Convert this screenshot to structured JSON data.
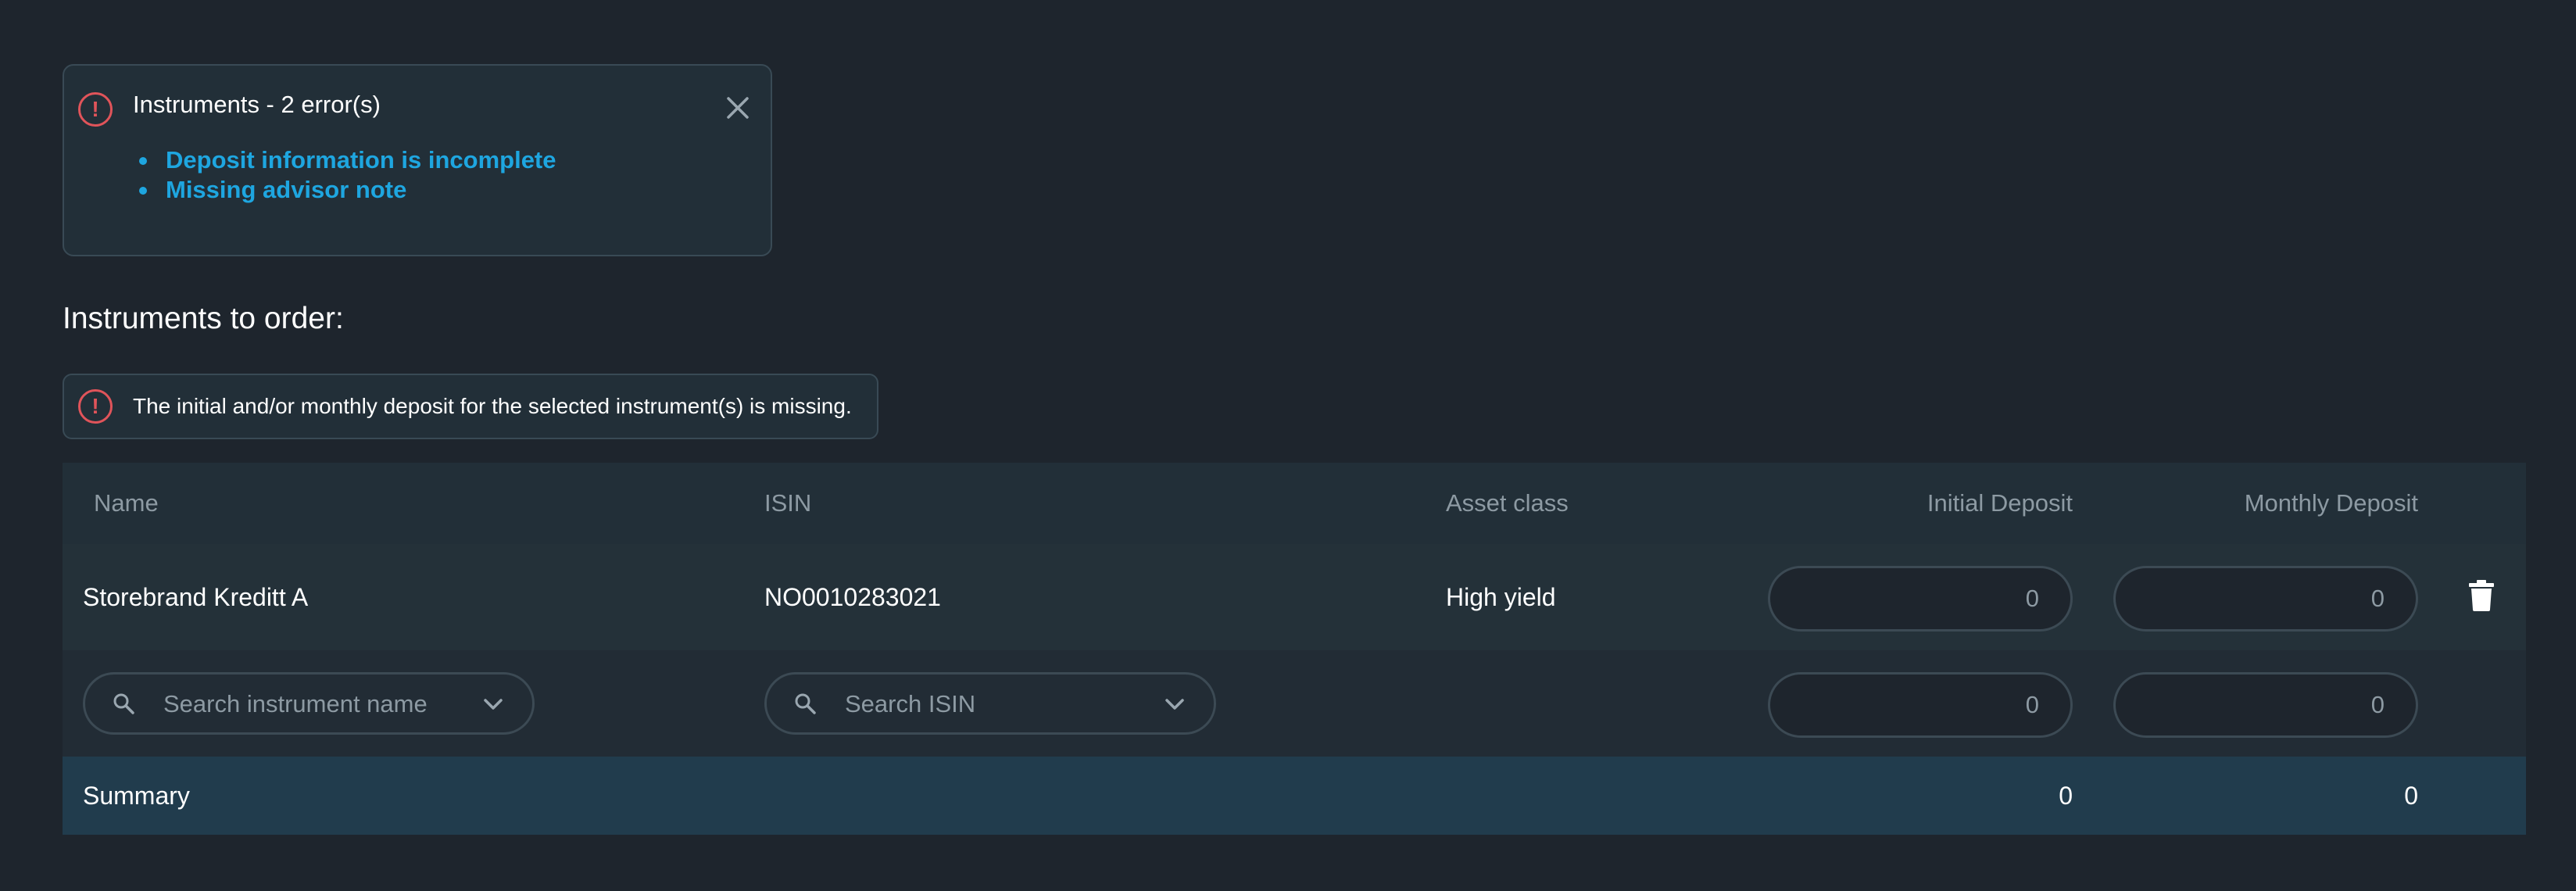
{
  "error_summary": {
    "title": "Instruments - 2 error(s)",
    "errors": [
      "Deposit information is incomplete",
      "Missing advisor note"
    ]
  },
  "section_title": "Instruments to order:",
  "inline_alert": "The initial and/or monthly deposit for the selected instrument(s) is missing.",
  "table": {
    "headers": {
      "name": "Name",
      "isin": "ISIN",
      "asset_class": "Asset class",
      "initial_deposit": "Initial Deposit",
      "monthly_deposit": "Monthly Deposit"
    },
    "rows": [
      {
        "name": "Storebrand Kreditt A",
        "isin": "NO0010283021",
        "asset_class": "High yield",
        "initial_deposit": "0",
        "monthly_deposit": "0"
      }
    ],
    "new_row": {
      "name_placeholder": "Search instrument name",
      "isin_placeholder": "Search ISIN",
      "initial_deposit": "0",
      "monthly_deposit": "0"
    },
    "summary": {
      "label": "Summary",
      "initial_total": "0",
      "monthly_total": "0"
    }
  },
  "colors": {
    "background": "#1e252d",
    "error": "#e0545a",
    "link": "#1ea6e0",
    "summary_row": "#213c4d"
  },
  "icons": [
    "alert-circle-icon",
    "close-icon",
    "search-icon",
    "chevron-down-icon",
    "trash-icon"
  ]
}
